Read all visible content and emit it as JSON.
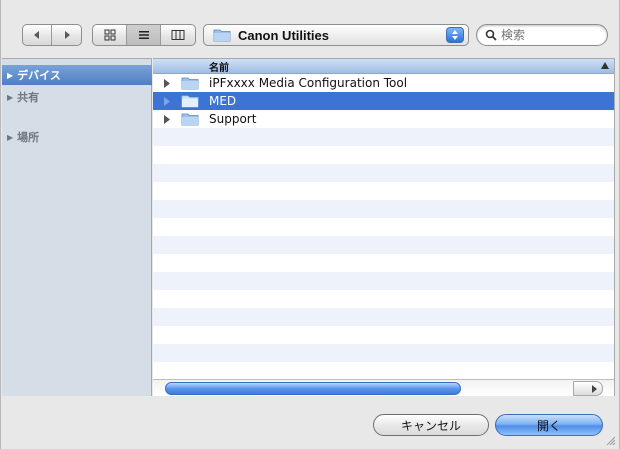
{
  "toolbar": {
    "view_icons": [
      "icon-view-icon",
      "list-view-icon",
      "column-view-icon"
    ],
    "location_label": "Canon Utilities",
    "search_placeholder": "検索"
  },
  "sidebar": {
    "items": [
      {
        "label": "デバイス",
        "selected": true
      },
      {
        "label": "共有",
        "selected": false
      },
      {
        "label": "場所",
        "selected": false
      }
    ]
  },
  "filelist": {
    "column_header": "名前",
    "rows": [
      {
        "name": "iPFxxxx Media Configuration Tool",
        "selected": false
      },
      {
        "name": "MED",
        "selected": true
      },
      {
        "name": "Support",
        "selected": false
      }
    ]
  },
  "buttons": {
    "cancel_label": "キャンセル",
    "open_label": "開く"
  },
  "colors": {
    "selection": "#3b74d4",
    "sidebar_bg": "#d5dde6",
    "stripe": "#eef3fb",
    "folder": "#8fb8e6"
  }
}
